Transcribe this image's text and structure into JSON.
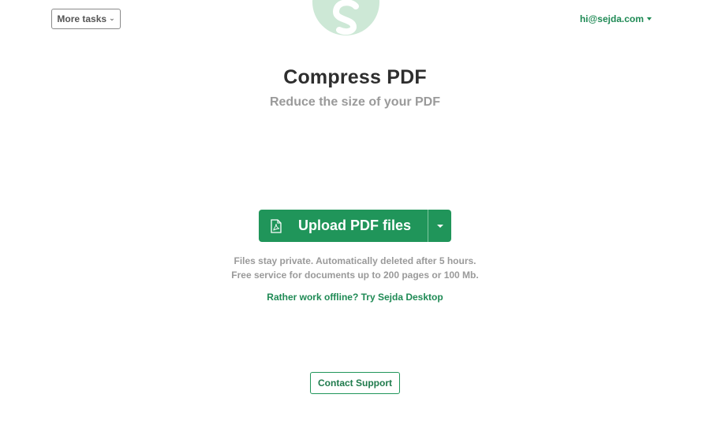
{
  "header": {
    "more_tasks_label": "More tasks",
    "account_email": "hi@sejda.com",
    "logo_icon": "sejda-s-logo-icon"
  },
  "main": {
    "title": "Compress PDF",
    "subtitle": "Reduce the size of your PDF",
    "upload_label": "Upload PDF files",
    "upload_icon": "pdf-file-icon",
    "info_line_1": "Files stay private. Automatically deleted after 5 hours.",
    "info_line_2": "Free service for documents up to 200 pages or 100 Mb.",
    "offline_link": "Rather work offline? Try Sejda Desktop"
  },
  "footer": {
    "contact_label": "Contact Support"
  },
  "colors": {
    "accent": "#20955a",
    "link": "#1f8a55",
    "logo_bg": "#cde8d6",
    "muted_text": "#9a9a9a",
    "title_text": "#2e2e2e"
  }
}
